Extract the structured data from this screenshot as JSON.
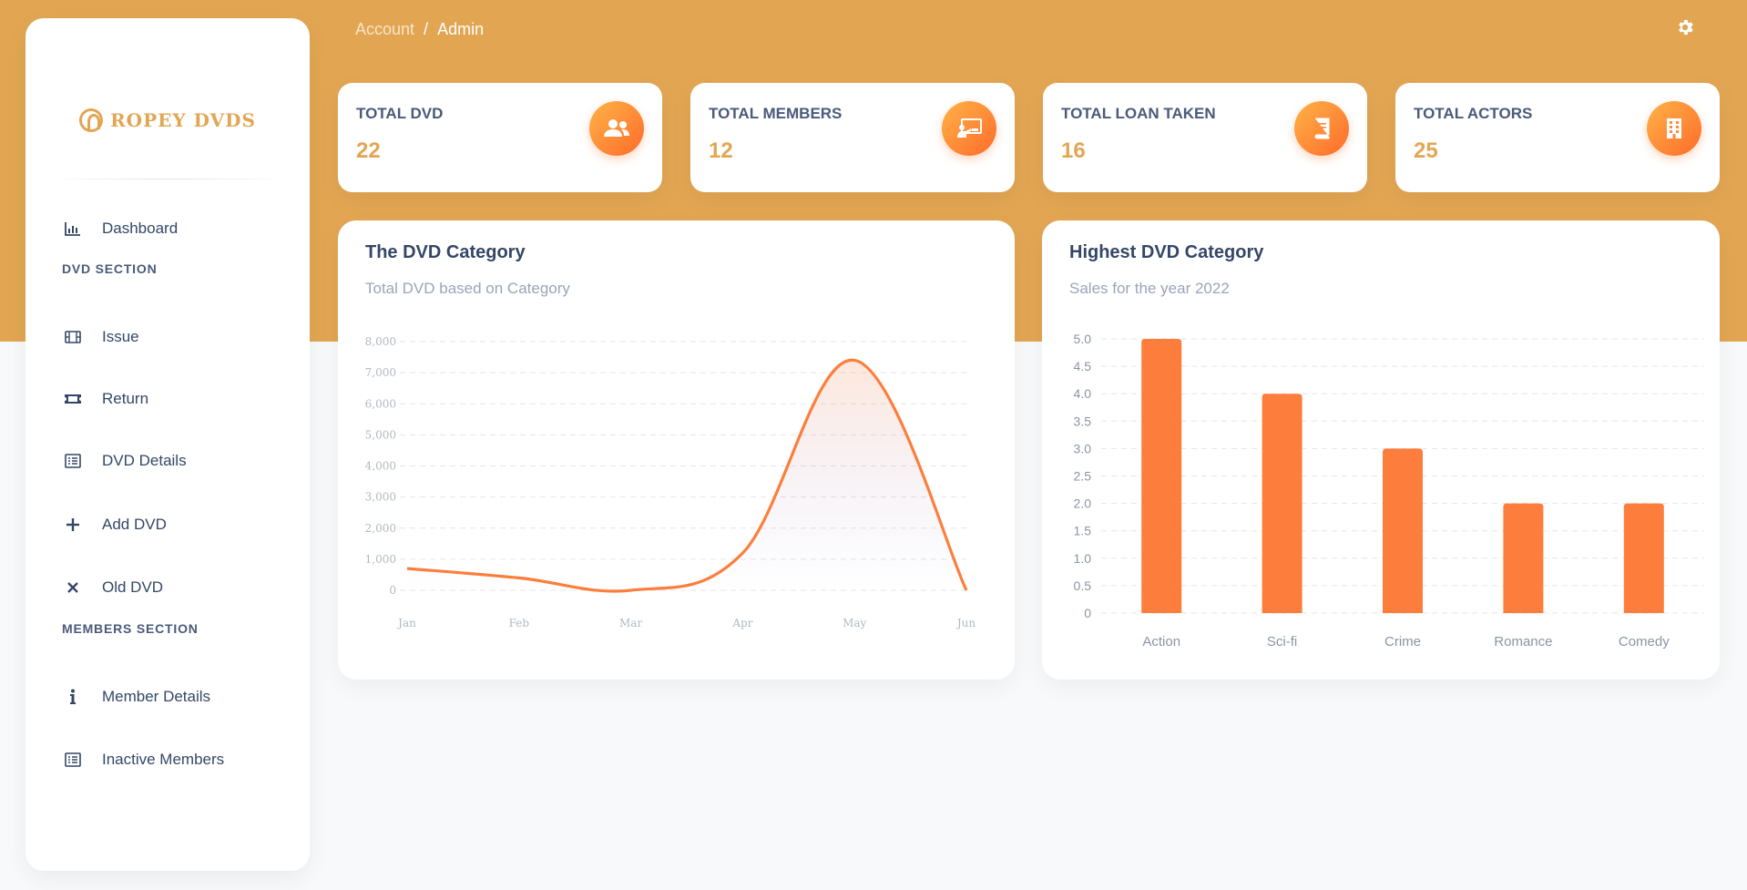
{
  "brand": {
    "name": "ROPEY DVDS"
  },
  "breadcrumb": {
    "parent": "Account",
    "separator": "/",
    "current": "Admin"
  },
  "sidebar": {
    "items": [
      {
        "label": "Dashboard",
        "icon": "chart-bar-icon"
      },
      {
        "section": "DVD SECTION"
      },
      {
        "label": "Issue",
        "icon": "film-icon"
      },
      {
        "label": "Return",
        "icon": "ticket-icon"
      },
      {
        "label": "DVD Details",
        "icon": "list-icon"
      },
      {
        "label": "Add DVD",
        "icon": "plus-icon"
      },
      {
        "label": "Old DVD",
        "icon": "close-icon"
      },
      {
        "section": "MEMBERS SECTION"
      },
      {
        "label": "Member Details",
        "icon": "info-icon"
      },
      {
        "label": "Inactive Members",
        "icon": "list-icon"
      }
    ]
  },
  "stats": [
    {
      "title": "TOTAL DVD",
      "value": "22",
      "icon": "users-icon"
    },
    {
      "title": "TOTAL MEMBERS",
      "value": "12",
      "icon": "presentation-icon"
    },
    {
      "title": "TOTAL LOAN TAKEN",
      "value": "16",
      "icon": "book-icon"
    },
    {
      "title": "TOTAL ACTORS",
      "value": "25",
      "icon": "building-icon"
    }
  ],
  "colors": {
    "accent": "#e2a653",
    "chart": "#fd7e3c",
    "text": "#344767"
  },
  "chart_data": [
    {
      "type": "area",
      "title": "The DVD Category",
      "subtitle": "Total DVD based on Category",
      "categories": [
        "Jan",
        "Feb",
        "Mar",
        "Apr",
        "May",
        "Jun"
      ],
      "series": [
        {
          "values": [
            700,
            400,
            0,
            1200,
            7400,
            0
          ]
        }
      ],
      "ylim": [
        0,
        8000
      ],
      "yticks": [
        "0",
        "1,000",
        "2,000",
        "3,000",
        "4,000",
        "5,000",
        "6,000",
        "7,000",
        "8,000"
      ],
      "grid": true
    },
    {
      "type": "bar",
      "title": "Highest DVD Category",
      "subtitle": "Sales for the year 2022",
      "categories": [
        "Action",
        "Sci-fi",
        "Crime",
        "Romance",
        "Comedy"
      ],
      "values": [
        5,
        4,
        3,
        2,
        2
      ],
      "ylim": [
        0,
        5
      ],
      "yticks": [
        "0",
        "0.5",
        "1.0",
        "1.5",
        "2.0",
        "2.5",
        "3.0",
        "3.5",
        "4.0",
        "4.5",
        "5.0"
      ],
      "grid": true
    }
  ]
}
